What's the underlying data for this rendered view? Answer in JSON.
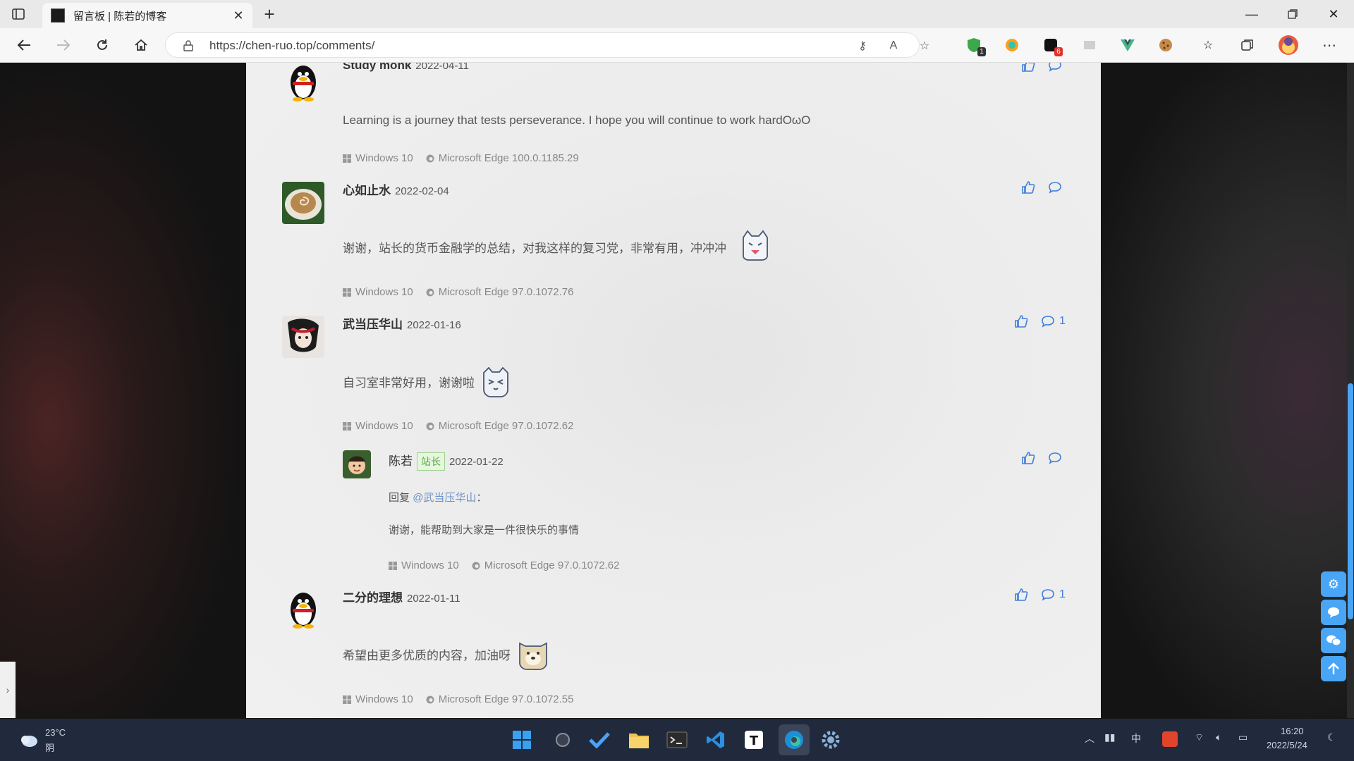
{
  "browser": {
    "tab_title": "留言板 | 陈若的博客",
    "url": "https://chen-ruo.top/comments/",
    "extension_badges": [
      "1",
      "6"
    ]
  },
  "comments": [
    {
      "name": "Study monk",
      "date": "2022-04-11",
      "text": "Learning is a journey that tests perseverance. I hope you will continue to work hardOωO",
      "os": "Windows 10",
      "browser": "Microsoft Edge 100.0.1185.29",
      "reply_count": "",
      "avatar": "qq-penguin-icon"
    },
    {
      "name": "心如止水",
      "date": "2022-02-04",
      "text": "谢谢，站长的货币金融学的总结，对我这样的复习党，非常有用，冲冲冲",
      "os": "Windows 10",
      "browser": "Microsoft Edge 97.0.1072.76",
      "reply_count": "",
      "avatar": "coffee-avatar"
    },
    {
      "name": "武当压华山",
      "date": "2022-01-16",
      "text": "自习室非常好用，谢谢啦",
      "os": "Windows 10",
      "browser": "Microsoft Edge 97.0.1072.62",
      "reply_count": "1",
      "avatar": "anime-avatar"
    },
    {
      "name": "二分的理想",
      "date": "2022-01-11",
      "text": "希望由更多优质的内容，加油呀",
      "os": "Windows 10",
      "browser": "Microsoft Edge 97.0.1072.55",
      "reply_count": "1",
      "avatar": "qq-penguin-icon"
    }
  ],
  "reply": {
    "name": "陈若",
    "role_tag": "站长",
    "date": "2022-01-22",
    "reply_prefix": "回复",
    "mention": "@武当压华山",
    "colon": "：",
    "text": "谢谢，能帮助到大家是一件很快乐的事情",
    "os": "Windows 10",
    "browser": "Microsoft Edge 97.0.1072.62"
  },
  "taskbar": {
    "weather_temp": "23°C",
    "weather_desc": "阴",
    "ime": "中",
    "time": "16:20",
    "date": "2022/5/24"
  },
  "colors": {
    "accent": "#49a5f5",
    "action_blue": "#3f7fdc",
    "owner_tag_green": "#5aa84a"
  }
}
